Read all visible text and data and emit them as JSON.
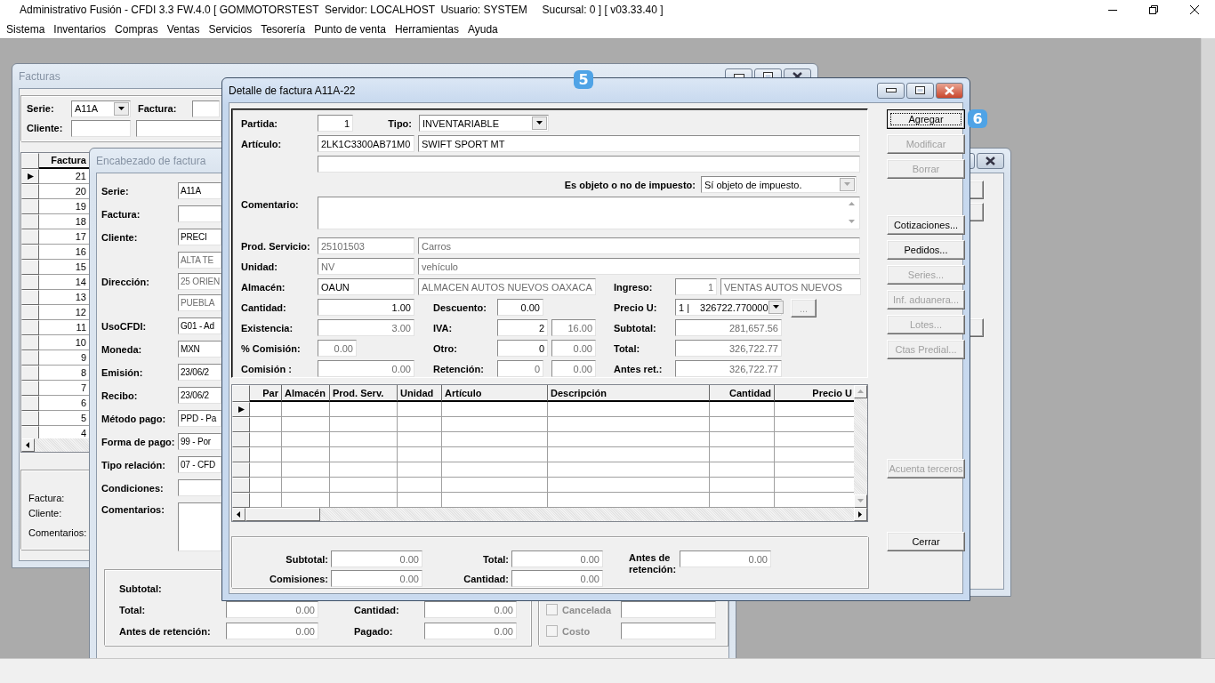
{
  "app": {
    "title": "Administrativo Fusión - CFDI 3.3 FW.4.0 [ GOMMOTORSTEST  Servidor: LOCALHOST  Usuario: SYSTEM     Sucursal: 0 ] [ v03.33.40 ]"
  },
  "menu": [
    "Sistema",
    "Inventarios",
    "Compras",
    "Ventas",
    "Servicios",
    "Tesorería",
    "Punto de venta",
    "Herramientas",
    "Ayuda"
  ],
  "facturas": {
    "title": "Facturas",
    "filter": {
      "serie_label": "Serie:",
      "serie": {
        "text": "A11A",
        "disabled": false
      },
      "factura_label": "Factura:",
      "cliente_label": "Cliente:"
    },
    "grid": {
      "column": "Factura",
      "rows": [
        {
          "factura": "21",
          "selected": true
        },
        {
          "factura": "20",
          "selected": false
        },
        {
          "factura": "19",
          "selected": false
        },
        {
          "factura": "18",
          "selected": false
        },
        {
          "factura": "17",
          "selected": false
        },
        {
          "factura": "16",
          "selected": false
        },
        {
          "factura": "15",
          "selected": false
        },
        {
          "factura": "14",
          "selected": false
        },
        {
          "factura": "13",
          "selected": false
        },
        {
          "factura": "12",
          "selected": false
        },
        {
          "factura": "11",
          "selected": false
        },
        {
          "factura": "10",
          "selected": false
        },
        {
          "factura": "9",
          "selected": false
        },
        {
          "factura": "8",
          "selected": false
        },
        {
          "factura": "7",
          "selected": false
        },
        {
          "factura": "6",
          "selected": false
        },
        {
          "factura": "5",
          "selected": false
        },
        {
          "factura": "4",
          "selected": false
        }
      ]
    },
    "footer": [
      "Factura:",
      "Cliente:",
      "Comentarios:"
    ]
  },
  "encabezado": {
    "title": "Encabezado de factura",
    "fields": [
      {
        "kind": "text",
        "label": "Serie:",
        "inputs": [
          {
            "text": "A11A",
            "disabled": false
          }
        ]
      },
      {
        "kind": "text",
        "label": "Factura:"
      },
      {
        "kind": "text",
        "label": "Cliente:",
        "inputs": [
          {
            "text": "PRECI",
            "disabled": false
          }
        ]
      },
      {
        "kind": "text",
        "label": "Dirección:",
        "inputs": [
          {
            "text": "ALTA TE",
            "disabled": true
          },
          {
            "text": "25 ORIEN",
            "disabled": true
          },
          {
            "text": "PUEBLA",
            "disabled": true
          }
        ]
      },
      {
        "kind": "text",
        "label": "UsoCFDI:",
        "inputs": [
          {
            "text": "G01 - Ad",
            "disabled": false
          }
        ]
      },
      {
        "kind": "text",
        "label": "Moneda:",
        "inputs": [
          {
            "text": "MXN",
            "disabled": false
          }
        ]
      },
      {
        "kind": "text",
        "label": "Emisión:",
        "inputs": [
          {
            "text": "23/06/2",
            "disabled": false
          }
        ]
      },
      {
        "kind": "text",
        "label": "Recibo:",
        "inputs": [
          {
            "text": "23/06/2",
            "disabled": false
          }
        ]
      },
      {
        "kind": "text",
        "label": "Método pago:",
        "inputs": [
          {
            "text": "PPD - Pa",
            "disabled": false
          }
        ]
      },
      {
        "kind": "text",
        "label": "Forma de pago:",
        "inputs": [
          {
            "text": "99 - Por",
            "disabled": false
          }
        ]
      },
      {
        "kind": "text",
        "label": "Tipo relación:",
        "inputs": [
          {
            "text": "07 - CFD",
            "disabled": false
          }
        ]
      },
      {
        "kind": "text",
        "label": "Condiciones:"
      },
      {
        "kind": "memo",
        "label": "Comentarios:"
      }
    ],
    "totals": [
      {
        "label": "Subtotal:"
      },
      {
        "label": "Total:",
        "input": {
          "text": "0.00",
          "disabled": true
        }
      },
      {
        "label": "Antes de retención:",
        "input": {
          "text": "0.00",
          "disabled": true
        }
      }
    ],
    "totals_right": [
      {
        "label": "Cantidad:",
        "input": {
          "text": "0.00",
          "disabled": true
        }
      },
      {
        "label": "Pagado:",
        "input": {
          "text": "0.00",
          "disabled": true
        }
      }
    ],
    "options": [
      {
        "label": "Cancelada",
        "checked": false,
        "disabled": true
      },
      {
        "label": "Costo",
        "checked": false,
        "disabled": true
      }
    ]
  },
  "detail": {
    "title": "Detalle de factura A11A-22",
    "badge": "5",
    "form": {
      "partida": {
        "label": "Partida:",
        "inputs": [
          {
            "text": "1",
            "disabled": false
          }
        ]
      },
      "tipo": {
        "label": "Tipo:",
        "inputs": [
          {
            "text": "INVENTARIABLE",
            "disabled": false
          }
        ]
      },
      "articulo": {
        "label": "Artículo:",
        "inputs": [
          {
            "text": "2LK1C3300AB71M0",
            "disabled": false
          },
          {
            "text": "SWIFT SPORT MT",
            "disabled": false
          }
        ]
      },
      "objeto": {
        "label": "Es objeto o no de impuesto:",
        "inputs": [
          {
            "text": "Sí objeto de impuesto.",
            "disabled": false
          }
        ]
      },
      "comentario": {
        "label": "Comentario:"
      },
      "prod_servicio": {
        "label": "Prod. Servicio:",
        "inputs": [
          {
            "text": "25101503",
            "disabled": true
          },
          {
            "text": "Carros",
            "disabled": true
          }
        ]
      },
      "unidad": {
        "label": "Unidad:",
        "inputs": [
          {
            "text": "NV",
            "disabled": true
          },
          {
            "text": "vehículo",
            "disabled": true
          }
        ]
      },
      "almacen": {
        "label": "Almacén:",
        "inputs": [
          {
            "text": "OAUN",
            "disabled": false
          },
          {
            "text": "ALMACEN AUTOS NUEVOS OAXACA",
            "disabled": true
          }
        ]
      },
      "ingreso": {
        "label": "Ingreso:",
        "inputs": [
          {
            "text": "1",
            "disabled": true
          },
          {
            "text": "VENTAS AUTOS NUEVOS",
            "disabled": true
          }
        ]
      },
      "cantidad": {
        "label": "Cantidad:",
        "inputs": [
          {
            "text": "1.00",
            "disabled": false
          }
        ]
      },
      "descuento": {
        "label": "Descuento:",
        "inputs": [
          {
            "text": "0.00",
            "disabled": false
          }
        ]
      },
      "precio": {
        "label": "Precio U:",
        "inputs": [
          {
            "text": "1 |",
            "disabled": false
          },
          {
            "text": "326722.770000",
            "disabled": false
          }
        ],
        "more": {
          "label": "...",
          "disabled": true
        }
      },
      "existencia": {
        "label": "Existencia:",
        "inputs": [
          {
            "text": "3.00",
            "disabled": true
          }
        ]
      },
      "iva": {
        "label": "IVA:",
        "inputs": [
          {
            "text": "2",
            "disabled": false
          },
          {
            "text": "16.00",
            "disabled": true
          }
        ]
      },
      "subtotal": {
        "label": "Subtotal:",
        "inputs": [
          {
            "text": "281,657.56",
            "disabled": true
          }
        ]
      },
      "pct_comision": {
        "label": "% Comisión:",
        "inputs": [
          {
            "text": "0.00",
            "disabled": true
          }
        ]
      },
      "otro": {
        "label": "Otro:",
        "inputs": [
          {
            "text": "0",
            "disabled": false
          },
          {
            "text": "0.00",
            "disabled": true
          }
        ]
      },
      "total": {
        "label": "Total:",
        "inputs": [
          {
            "text": "326,722.77",
            "disabled": true
          }
        ]
      },
      "comision": {
        "label": "Comisión :",
        "inputs": [
          {
            "text": "0.00",
            "disabled": true
          }
        ]
      },
      "retencion": {
        "label": "Retención:",
        "inputs": [
          {
            "text": "0",
            "disabled": true
          },
          {
            "text": "0.00",
            "disabled": true
          }
        ]
      },
      "antes_ret": {
        "label": "Antes ret.:",
        "inputs": [
          {
            "text": "326,722.77",
            "disabled": true
          }
        ]
      }
    },
    "grid": {
      "columns": [
        "Par",
        "Almacén",
        "Prod. Serv.",
        "Unidad",
        "Artículo",
        "Descripción",
        "Cantidad",
        "Precio U"
      ],
      "rows": [
        {
          "selected": true
        },
        {
          "selected": false
        },
        {
          "selected": false
        },
        {
          "selected": false
        },
        {
          "selected": false
        },
        {
          "selected": false
        },
        {
          "selected": false
        }
      ]
    },
    "totals": [
      {
        "label": "Subtotal:",
        "input": {
          "text": "0.00",
          "disabled": true
        }
      },
      {
        "label": "Total:",
        "input": {
          "text": "0.00",
          "disabled": true
        }
      },
      {
        "label": "Antes de retención:",
        "input": {
          "text": "0.00",
          "disabled": true
        }
      },
      {
        "label": "Comisiones:",
        "input": {
          "text": "0.00",
          "disabled": true
        }
      },
      {
        "label": "Cantidad:",
        "input": {
          "text": "0.00",
          "disabled": true
        }
      }
    ],
    "button_groups": [
      [
        {
          "label": "Agregar",
          "disabled": false,
          "default": true,
          "badge": "6"
        },
        {
          "label": "Modificar",
          "disabled": true,
          "default": false
        },
        {
          "label": "Borrar",
          "disabled": true,
          "default": false
        }
      ],
      [
        {
          "label": "Cotizaciones...",
          "disabled": false,
          "default": false
        },
        {
          "label": "Pedidos...",
          "disabled": false,
          "default": false
        },
        {
          "label": "Series...",
          "disabled": true,
          "default": false
        },
        {
          "label": "Inf. aduanera...",
          "disabled": true,
          "default": false
        },
        {
          "label": "Lotes...",
          "disabled": true,
          "default": false
        },
        {
          "label": "Ctas Predial...",
          "disabled": true,
          "default": false
        }
      ],
      [
        {
          "label": "Acuenta terceros",
          "disabled": true,
          "default": false
        }
      ],
      [
        {
          "label": "Cerrar",
          "disabled": false,
          "default": false
        }
      ]
    ]
  }
}
